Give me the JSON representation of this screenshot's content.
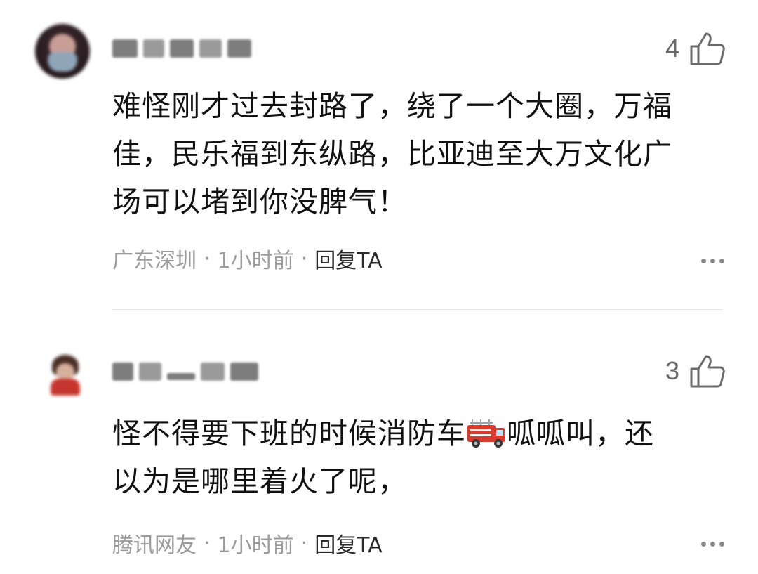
{
  "comments": [
    {
      "like_count": "4",
      "text_lines": [
        "难怪刚才过去封路了，绕了一个大圈，万福",
        "佳，民乐福到东纵路，比亚迪至大万文化广",
        "场可以堵到你没脾气！"
      ],
      "location": "广东深圳",
      "time": "1小时前",
      "reply": "回复TA",
      "separator": "·"
    },
    {
      "like_count": "3",
      "text_before_emoji": "怪不得要下班的时候消防车",
      "text_after_emoji": "呱呱叫，还",
      "emoji": "fire-engine-emoji",
      "text_line2": "以为是哪里着火了呢，",
      "location": "腾讯网友",
      "time": "1小时前",
      "reply": "回复TA",
      "separator": "·"
    }
  ],
  "icons": {
    "like": "thumbs-up-icon",
    "more": "more-dots-icon"
  },
  "colors": {
    "text": "#111111",
    "meta": "#9b9b9b",
    "like": "#6b6b6b",
    "divider": "#e8e8e8"
  }
}
